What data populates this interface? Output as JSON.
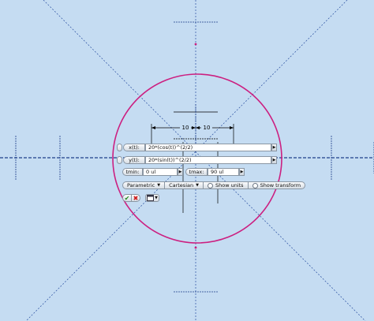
{
  "canvas": {
    "colors": {
      "background": "#c5dcf2",
      "curve": "#cc1f80",
      "axes": "#1e3f8a",
      "dim": "#000000"
    }
  },
  "dimensions": {
    "left": "10",
    "right": "10"
  },
  "x_row": {
    "label": "x(t):",
    "expression": "20*(cos(t))^(2/2)"
  },
  "y_row": {
    "label": "y(t):",
    "expression": "20*(sin(t))^(2/2)"
  },
  "t_row": {
    "tmin_label": "tmin:",
    "tmin_value": "0 ul",
    "tmax_label": "tmax:",
    "tmax_value": "90 ul"
  },
  "options": {
    "type_label": "Parametric",
    "coord_label": "Cartesian",
    "show_units_label": "Show units",
    "show_transform_label": "Show transform"
  },
  "actions": {
    "ok_icon": "check-icon",
    "cancel_icon": "x-icon",
    "options_icon": "window-icon"
  }
}
